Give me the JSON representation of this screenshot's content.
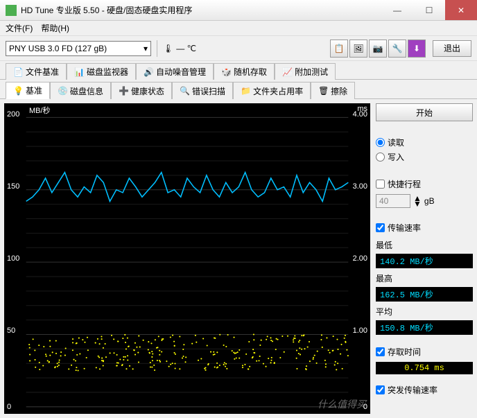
{
  "window": {
    "title": "HD Tune 专业版 5.50 - 硬盘/固态硬盘实用程序"
  },
  "menu": {
    "file": "文件(F)",
    "help": "帮助(H)"
  },
  "toolbar": {
    "drive": "PNY  USB 3.0 FD (127 gB)",
    "temp": "— ℃",
    "exit": "退出"
  },
  "tabs_row1": {
    "file_bench": "文件基准",
    "disk_monitor": "磁盘监视器",
    "noise": "自动噪音管理",
    "random": "随机存取",
    "extra": "附加测试"
  },
  "tabs_row2": {
    "benchmark": "基准",
    "disk_info": "磁盘信息",
    "health": "健康状态",
    "error_scan": "错误扫描",
    "folder_usage": "文件夹占用率",
    "erase": "擦除"
  },
  "sidebar": {
    "start": "开始",
    "read": "读取",
    "write": "写入",
    "short_stroke": "快捷行程",
    "short_stroke_val": "40",
    "short_stroke_unit": "gB",
    "transfer_rate": "传输速率",
    "min": "最低",
    "min_val": "140.2 MB/秒",
    "max": "最高",
    "max_val": "162.5 MB/秒",
    "avg": "平均",
    "avg_val": "150.8 MB/秒",
    "access_time": "存取时间",
    "access_val": "0.754 ms",
    "burst": "突发传输速率"
  },
  "chart_data": {
    "type": "line",
    "y_left_label": "MB/秒",
    "y_right_label": "ms",
    "y_left_ticks": [
      0,
      50,
      100,
      150,
      200
    ],
    "y_right_ticks": [
      0,
      1.0,
      2.0,
      3.0,
      4.0
    ],
    "ylim_left": [
      0,
      200
    ],
    "ylim_right": [
      0,
      4.0
    ],
    "series": [
      {
        "name": "transfer_rate",
        "axis": "left",
        "color": "#00BFFF",
        "x": [
          0,
          2,
          4,
          6,
          8,
          10,
          12,
          14,
          16,
          18,
          20,
          22,
          24,
          26,
          28,
          30,
          32,
          34,
          36,
          38,
          40,
          42,
          44,
          46,
          48,
          50,
          52,
          54,
          56,
          58,
          60,
          62,
          64,
          66,
          68,
          70,
          72,
          74,
          76,
          78,
          80,
          82,
          84,
          86,
          88,
          90,
          92,
          94,
          96,
          98,
          100
        ],
        "values": [
          142,
          145,
          150,
          158,
          148,
          155,
          162,
          150,
          145,
          152,
          148,
          160,
          155,
          142,
          150,
          148,
          158,
          152,
          145,
          150,
          155,
          162,
          148,
          150,
          145,
          158,
          152,
          148,
          160,
          150,
          145,
          155,
          148,
          152,
          162,
          150,
          145,
          148,
          158,
          150,
          152,
          145,
          160,
          148,
          155,
          150,
          142,
          158,
          150,
          152,
          155
        ]
      },
      {
        "name": "access_time",
        "axis": "right",
        "color": "#FFFF00",
        "type": "scatter",
        "approx_range": [
          0.5,
          1.0
        ],
        "mean": 0.754
      }
    ]
  },
  "watermark": "什么值得买"
}
